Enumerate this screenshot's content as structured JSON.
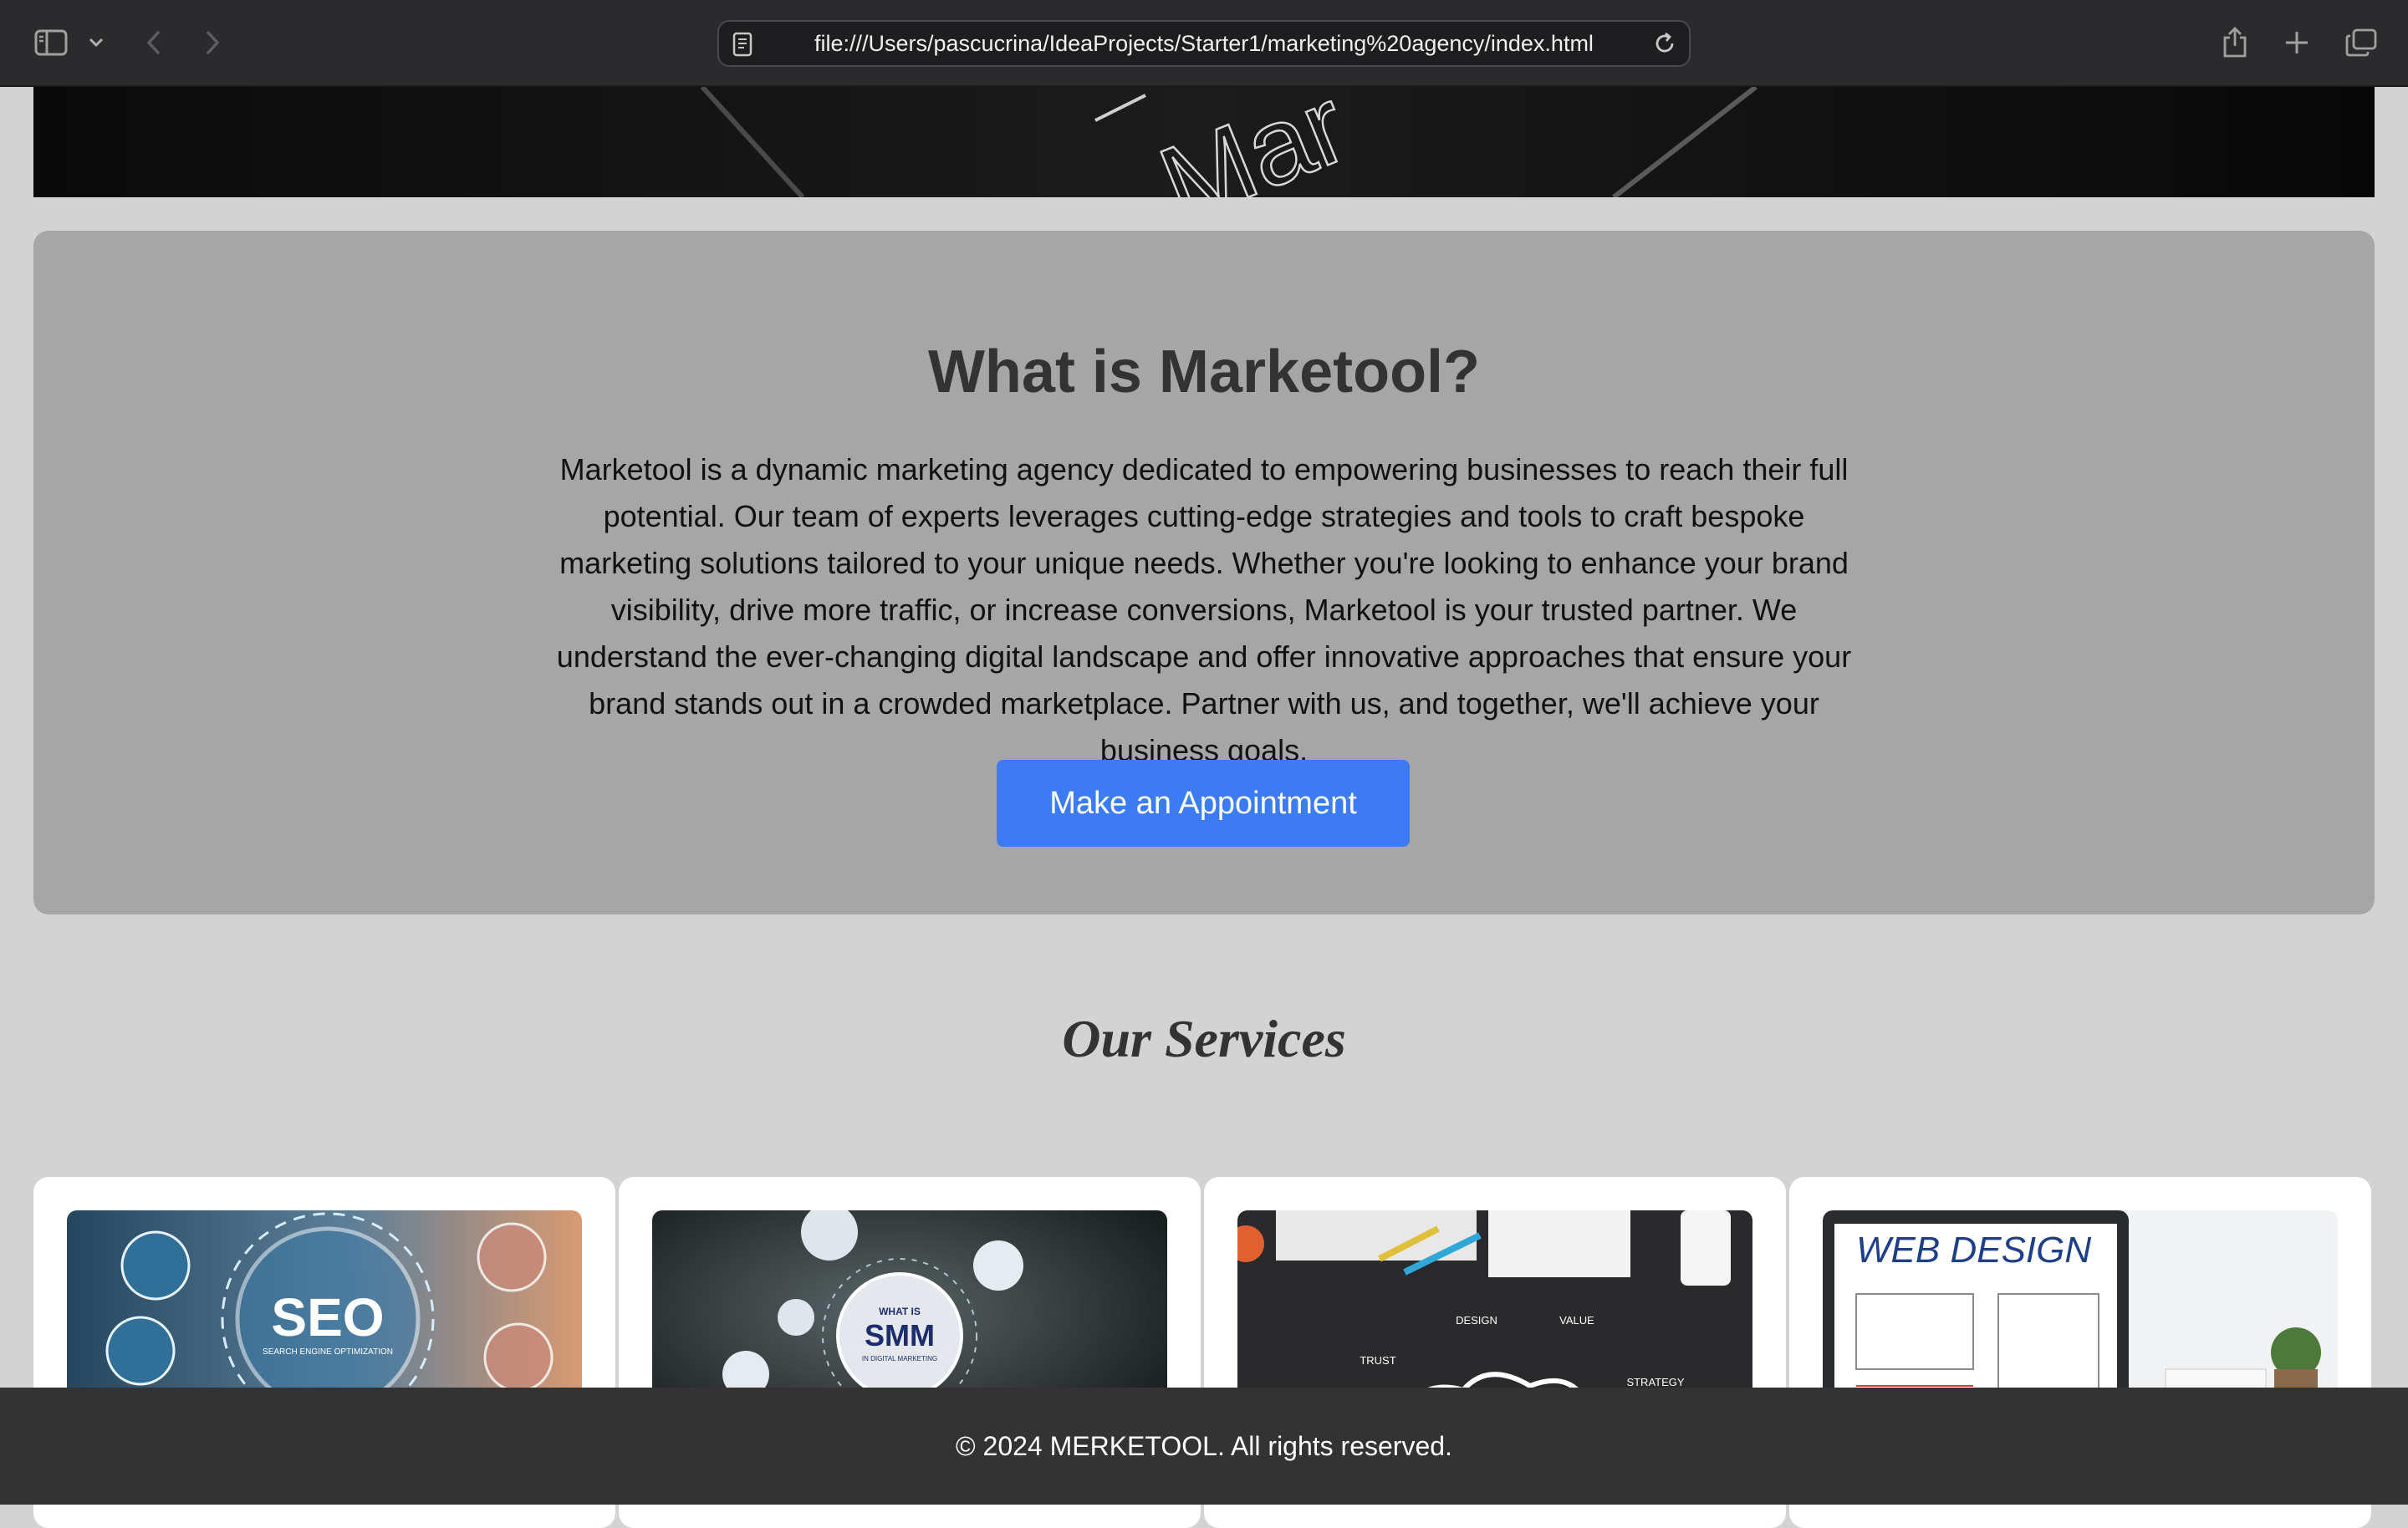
{
  "browser": {
    "url": "file:///Users/pascucrina/IdeaProjects/Starter1/marketing%20agency/index.html",
    "icons": [
      "sidebar-icon",
      "chevron-down-icon",
      "back-icon",
      "forward-icon",
      "page-icon",
      "reload-icon",
      "share-icon",
      "plus-icon",
      "tabs-icon"
    ]
  },
  "hero": {
    "text": "Mar"
  },
  "about": {
    "title": "What is Marketool?",
    "paragraph": "Marketool is a dynamic marketing agency dedicated to empowering businesses to reach their full potential. Our team of experts leverages cutting-edge strategies and tools to craft bespoke marketing solutions tailored to your unique needs. Whether you're looking to enhance your brand visibility, drive more traffic, or increase conversions, Marketool is your trusted partner. We understand the ever-changing digital landscape and offer innovative approaches that ensure your brand stands out in a crowded marketplace. Partner with us, and together, we'll achieve your business goals.",
    "button_label": "Make an Appointment",
    "button_color": "#3b7cf4"
  },
  "services": {
    "title": "Our Services",
    "cards": [
      {
        "image_text": "SEO",
        "image_subtext": "SEARCH ENGINE OPTIMIZATION"
      },
      {
        "image_text": "SMM",
        "image_top": "WHAT IS",
        "image_subtext": "IN DIGITAL MARKETING"
      },
      {
        "labels": [
          "DESIGN",
          "VALUE",
          "TRUST",
          "STRATEGY"
        ]
      },
      {
        "image_text": "WEB DESIGN"
      }
    ]
  },
  "footer": {
    "text": "© 2024 MERKETOOL. All rights reserved."
  }
}
